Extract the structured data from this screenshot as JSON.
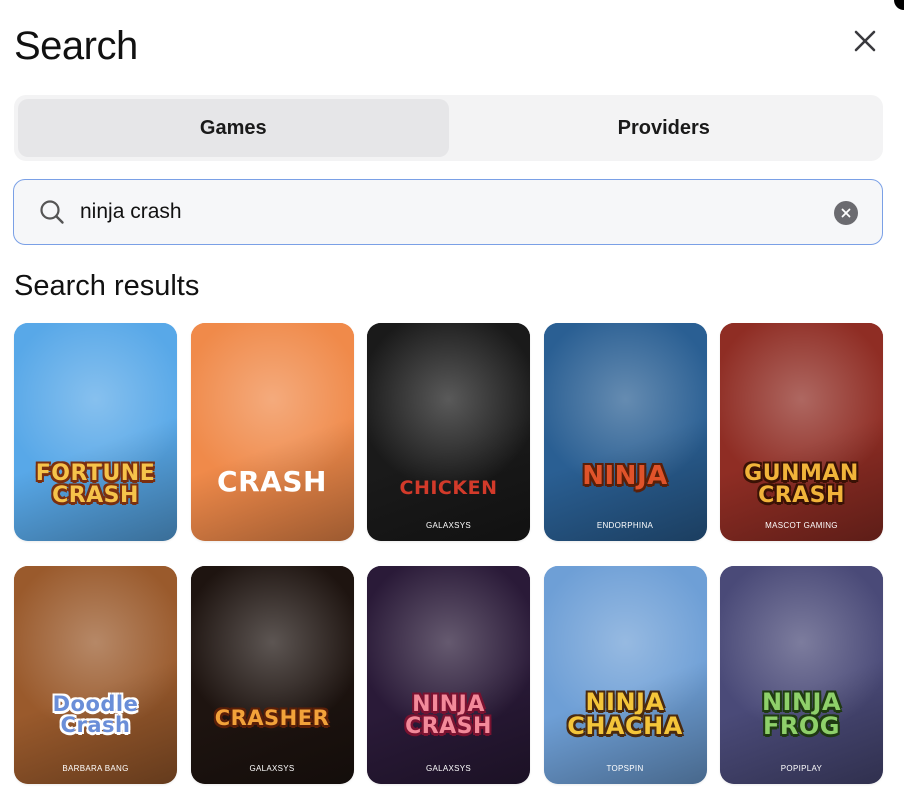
{
  "header": {
    "title": "Search",
    "close_icon": "close-icon"
  },
  "tabs": [
    {
      "label": "Games",
      "active": true
    },
    {
      "label": "Providers",
      "active": false
    }
  ],
  "search": {
    "value": "ninja crash",
    "icon": "search-icon",
    "clear_icon": "clear-icon"
  },
  "results": {
    "title": "Search results",
    "games": [
      {
        "name": "FORTUNE\nCRASH",
        "provider": "",
        "bg": "#58a8e8",
        "text_color": "#f6c34a",
        "stroke": "#7a2f10"
      },
      {
        "name": "CRASH",
        "provider": "",
        "bg": "#f08a4a",
        "text_color": "#ffffff",
        "stroke": ""
      },
      {
        "name": "CHICKEN",
        "provider": "GALAXSYS",
        "bg": "#1a1a1a",
        "text_color": "#d23a2a",
        "stroke": ""
      },
      {
        "name": "NINJA",
        "provider": "ENDORPHINA",
        "bg": "#2a5f93",
        "text_color": "#e0532a",
        "stroke": "#5a1f08"
      },
      {
        "name": "GUNMAN\nCRASH",
        "provider": "MASCOT GAMING",
        "bg": "#8f2d24",
        "text_color": "#f1b43a",
        "stroke": "#3a1205"
      },
      {
        "name": "Doodle\nCrash",
        "provider": "BARBARA BANG",
        "bg": "#9a5a2c",
        "text_color": "#6a8ed8",
        "stroke": "#ffffff"
      },
      {
        "name": "CRASHER",
        "provider": "GALAXSYS",
        "bg": "#1e1410",
        "text_color": "#f2a23a",
        "stroke": "#5a1f08"
      },
      {
        "name": "NINJA\nCRASH",
        "provider": "GALAXSYS",
        "bg": "#2a1a38",
        "text_color": "#f38a9a",
        "stroke": "#7a1230"
      },
      {
        "name": "NINJA\nCHACHA",
        "provider": "TOPSPIN",
        "bg": "#6e9fd6",
        "text_color": "#f4c53a",
        "stroke": "#4a2a10"
      },
      {
        "name": "NINJA\nFROG",
        "provider": "POPIPLAY",
        "bg": "#4a4a78",
        "text_color": "#8ed06a",
        "stroke": "#1f3a12"
      }
    ]
  }
}
